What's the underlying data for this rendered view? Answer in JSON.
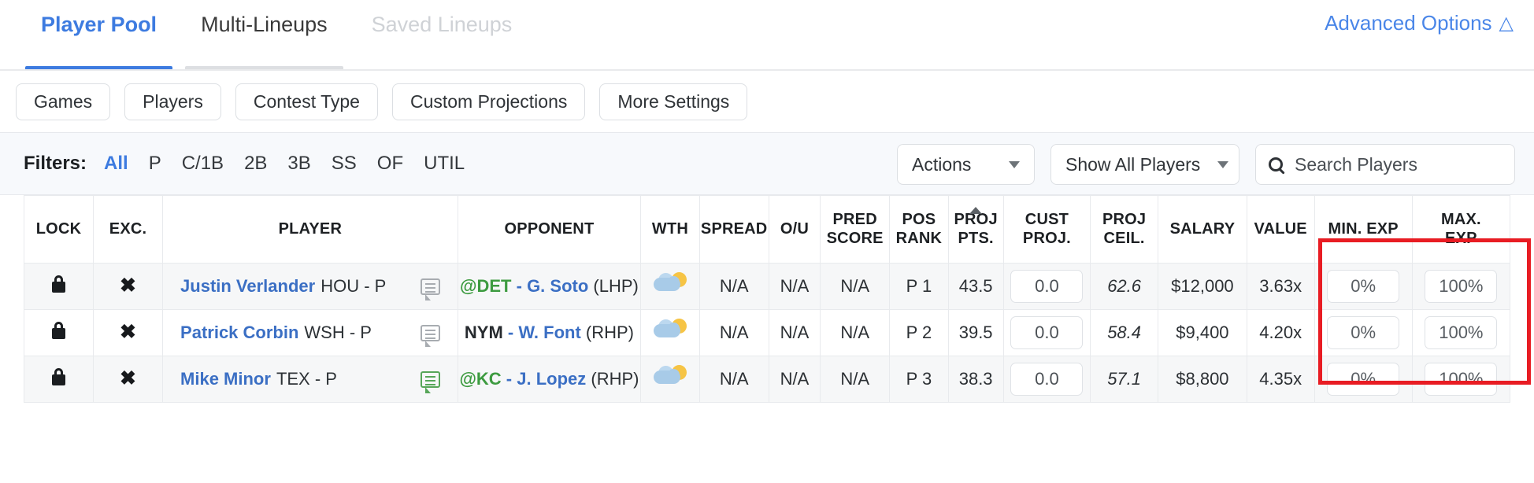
{
  "header": {
    "tabs": [
      {
        "label": "Player Pool",
        "state": "active"
      },
      {
        "label": "Multi-Lineups",
        "state": "normal"
      },
      {
        "label": "Saved Lineups",
        "state": "disabled"
      }
    ],
    "advanced_options_label": "Advanced Options",
    "advanced_options_icon": "chevron-double-up-icon",
    "accent_color": "#3d7be0"
  },
  "settings_buttons": [
    {
      "label": "Games"
    },
    {
      "label": "Players"
    },
    {
      "label": "Contest Type"
    },
    {
      "label": "Custom Projections"
    },
    {
      "label": "More Settings"
    }
  ],
  "filters": {
    "label": "Filters:",
    "options": [
      {
        "label": "All",
        "active": true
      },
      {
        "label": "P",
        "active": false
      },
      {
        "label": "C/1B",
        "active": false
      },
      {
        "label": "2B",
        "active": false
      },
      {
        "label": "3B",
        "active": false
      },
      {
        "label": "SS",
        "active": false
      },
      {
        "label": "OF",
        "active": false
      },
      {
        "label": "UTIL",
        "active": false
      }
    ],
    "actions_label": "Actions",
    "show_players_label": "Show All Players",
    "search_placeholder": "Search Players",
    "search_value": "",
    "search_icon": "search-icon"
  },
  "table": {
    "columns": [
      {
        "key": "lock",
        "label": "LOCK"
      },
      {
        "key": "exc",
        "label": "EXC."
      },
      {
        "key": "player",
        "label": "PLAYER"
      },
      {
        "key": "opponent",
        "label": "OPPONENT"
      },
      {
        "key": "wth",
        "label": "WTH"
      },
      {
        "key": "spread",
        "label": "SPREAD"
      },
      {
        "key": "ou",
        "label": "O/U"
      },
      {
        "key": "pred_score",
        "label": "PRED SCORE",
        "line1": "PRED",
        "line2": "SCORE"
      },
      {
        "key": "pos_rank",
        "label": "POS RANK",
        "line1": "POS",
        "line2": "RANK"
      },
      {
        "key": "proj_pts",
        "label": "PROJ PTS.",
        "line1": "PROJ",
        "line2": "PTS.",
        "sorted": "asc"
      },
      {
        "key": "cust_proj",
        "label": "CUST PROJ.",
        "line1": "CUST",
        "line2": "PROJ."
      },
      {
        "key": "proj_ceil",
        "label": "PROJ CEIL.",
        "line1": "PROJ",
        "line2": "CEIL."
      },
      {
        "key": "salary",
        "label": "SALARY"
      },
      {
        "key": "value",
        "label": "VALUE"
      },
      {
        "key": "min_exp",
        "label": "MIN. EXP",
        "line1": "MIN. EXP",
        "line2": ""
      },
      {
        "key": "max_exp",
        "label": "MAX. EXP",
        "line1": "MAX.",
        "line2": "EXP"
      }
    ],
    "rows": [
      {
        "lock_icon": "lock-icon",
        "exclude_icon": "x-icon",
        "player_name": "Justin Verlander",
        "player_team_pos": "HOU - P",
        "note_icon": "note-icon",
        "note_state": "gray",
        "opponent_team": "@DET",
        "opponent_location": "away",
        "opponent_pitcher": "- G. Soto",
        "opponent_hand": "(LHP)",
        "weather_icon": "sun-behind-cloud-icon",
        "spread": "N/A",
        "ou": "N/A",
        "pred_score": "N/A",
        "pos_rank": "P 1",
        "proj_pts": "43.5",
        "cust_proj": "0.0",
        "proj_ceil": "62.6",
        "salary": "$12,000",
        "value": "3.63x",
        "min_exp": "0%",
        "max_exp": "100%"
      },
      {
        "lock_icon": "lock-icon",
        "exclude_icon": "x-icon",
        "player_name": "Patrick Corbin",
        "player_team_pos": "WSH - P",
        "note_icon": "note-icon",
        "note_state": "gray",
        "opponent_team": "NYM",
        "opponent_location": "home",
        "opponent_pitcher": "- W. Font",
        "opponent_hand": "(RHP)",
        "weather_icon": "sun-behind-cloud-icon",
        "spread": "N/A",
        "ou": "N/A",
        "pred_score": "N/A",
        "pos_rank": "P 2",
        "proj_pts": "39.5",
        "cust_proj": "0.0",
        "proj_ceil": "58.4",
        "salary": "$9,400",
        "value": "4.20x",
        "min_exp": "0%",
        "max_exp": "100%"
      },
      {
        "lock_icon": "lock-icon",
        "exclude_icon": "x-icon",
        "player_name": "Mike Minor",
        "player_team_pos": "TEX - P",
        "note_icon": "note-icon",
        "note_state": "green",
        "opponent_team": "@KC",
        "opponent_location": "away",
        "opponent_pitcher": "- J. Lopez",
        "opponent_hand": "(RHP)",
        "weather_icon": "sun-behind-cloud-icon",
        "spread": "N/A",
        "ou": "N/A",
        "pred_score": "N/A",
        "pos_rank": "P 3",
        "proj_pts": "38.3",
        "cust_proj": "0.0",
        "proj_ceil": "57.1",
        "salary": "$8,800",
        "value": "4.35x",
        "min_exp": "0%",
        "max_exp": "100%"
      }
    ]
  },
  "annotation": {
    "highlight_color": "#e81c23",
    "highlight_target": "min-max-exposure-columns"
  }
}
